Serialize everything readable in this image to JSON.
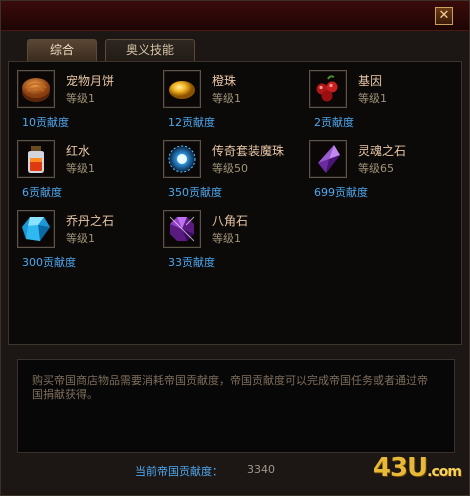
{
  "window": {
    "close_glyph": "✕"
  },
  "tabs": [
    {
      "label": "综合",
      "active": true
    },
    {
      "label": "奥义技能",
      "active": false
    }
  ],
  "items": [
    {
      "name": "宠物月饼",
      "level": "等级1",
      "cost": "10贡献度",
      "icon": "mooncake-icon"
    },
    {
      "name": "橙珠",
      "level": "等级1",
      "cost": "12贡献度",
      "icon": "orange-pearl-icon"
    },
    {
      "name": "基因",
      "level": "等级1",
      "cost": "2贡献度",
      "icon": "gene-berries-icon"
    },
    {
      "name": "红水",
      "level": "等级1",
      "cost": "6贡献度",
      "icon": "red-potion-icon"
    },
    {
      "name": "传奇套装魔珠",
      "level": "等级50",
      "cost": "350贡献度",
      "icon": "magic-orb-icon"
    },
    {
      "name": "灵魂之石",
      "level": "等级65",
      "cost": "699贡献度",
      "icon": "soul-stone-icon"
    },
    {
      "name": "乔丹之石",
      "level": "等级1",
      "cost": "300贡献度",
      "icon": "jordan-stone-icon"
    },
    {
      "name": "八角石",
      "level": "等级1",
      "cost": "33贡献度",
      "icon": "octagon-stone-icon"
    }
  ],
  "description": "购买帝国商店物品需要消耗帝国贡献度，帝国贡献度可以完成帝国任务或者通过帝国捐献获得。",
  "balance": {
    "label": "当前帝国贡献度：",
    "value": "3340"
  },
  "watermark": {
    "main": "43U",
    "suffix": ".com"
  }
}
